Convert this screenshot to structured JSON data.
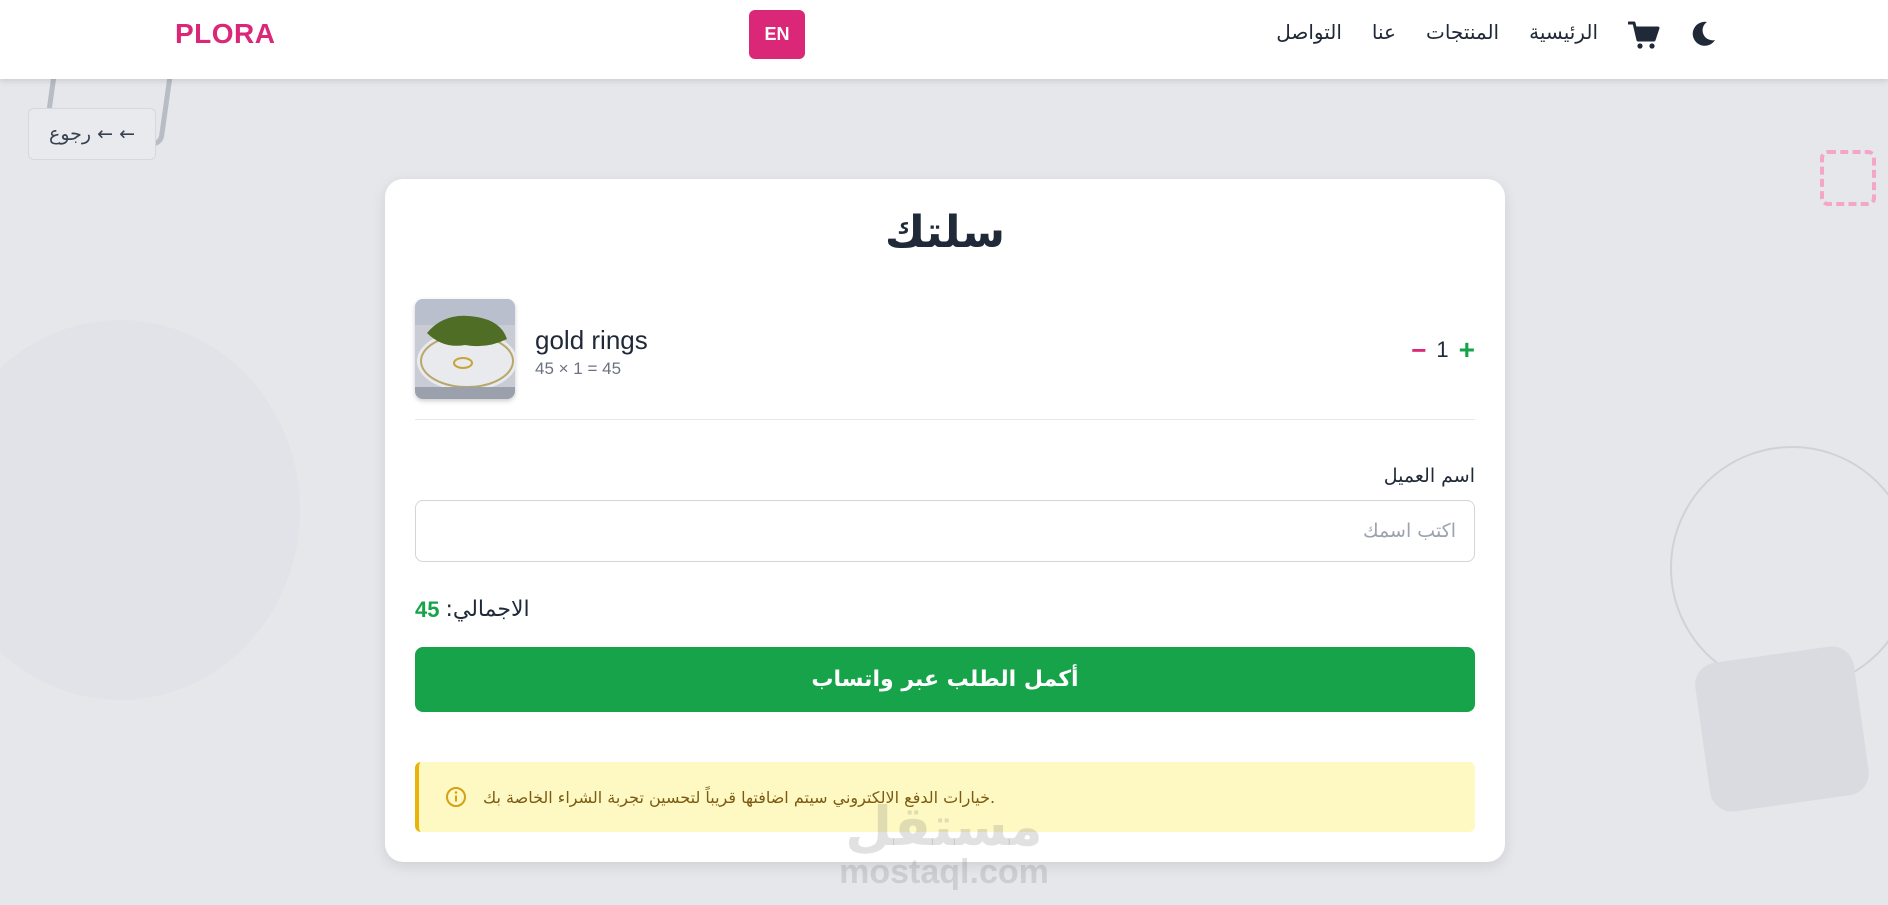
{
  "brand": "PLORA",
  "lang_button": "EN",
  "nav": {
    "items": [
      "الرئيسية",
      "المنتجات",
      "عنا",
      "التواصل"
    ]
  },
  "icons": {
    "cart": "shopping-cart-icon",
    "theme": "moon-icon",
    "info": "info-circle-icon"
  },
  "back_button": "رجوع ← ←",
  "cart": {
    "title": "سلتك",
    "item": {
      "name": "gold rings",
      "calc": "45 × 1 = 45",
      "quantity": "1",
      "minus_label": "−",
      "plus_label": "+"
    },
    "customer_label": "اسم العميل",
    "customer_placeholder": "اكتب اسمك",
    "customer_value": "",
    "total_label": "الاجمالي:",
    "total_value": "45",
    "checkout_button": "أكمل الطلب عبر واتساب",
    "notice": "خيارات الدفع الالكتروني سيتم اضافتها قريباً لتحسين تجربة الشراء الخاصة بك."
  },
  "watermark": {
    "arabic": "مستقل",
    "latin": "mostaql.com"
  },
  "colors": {
    "brand": "#db2777",
    "success": "#16a34a",
    "notice_bg": "#fef9c3",
    "notice_border": "#eab308",
    "page_bg": "#e5e7eb"
  }
}
